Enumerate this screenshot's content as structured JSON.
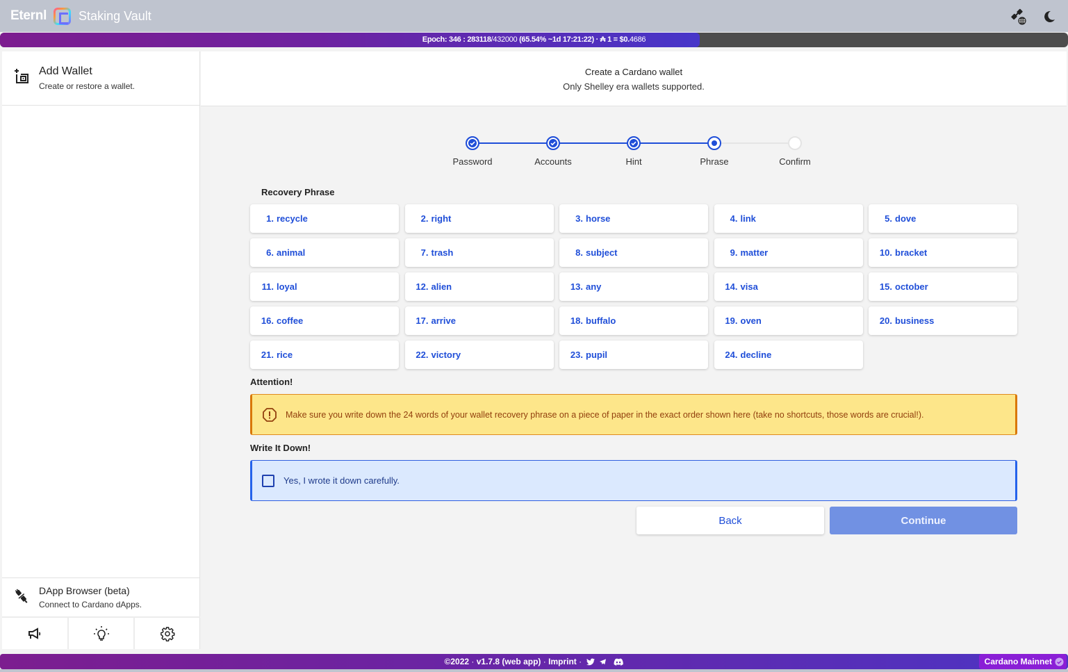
{
  "header": {
    "brand": "Eternl",
    "subtitle": "Staking Vault",
    "icons": [
      "dapp-network-icon",
      "dark-mode-moon-icon"
    ]
  },
  "epoch": {
    "label": "Epoch: 346 : 283118",
    "total": "/432000",
    "progress_text": " (65.54% ~1d 17:21:22) · ₳ 1 = $0.",
    "price_tail": "4686",
    "progress_fraction": 0.6554
  },
  "sidebar": {
    "add_wallet": {
      "title": "Add Wallet",
      "desc": "Create or restore a wallet.",
      "icon": "add-wallet-icon"
    },
    "dapp": {
      "title": "DApp Browser (beta)",
      "desc": "Connect to Cardano dApps.",
      "icon": "plug-icon"
    },
    "bottom_icons": [
      "megaphone-icon",
      "lightbulb-icon",
      "gear-icon"
    ]
  },
  "main": {
    "title": "Create a Cardano wallet",
    "subtitle": "Only Shelley era wallets supported."
  },
  "stepper": {
    "steps": [
      {
        "label": "Password",
        "state": "done"
      },
      {
        "label": "Accounts",
        "state": "done"
      },
      {
        "label": "Hint",
        "state": "done"
      },
      {
        "label": "Phrase",
        "state": "active"
      },
      {
        "label": "Confirm",
        "state": "todo"
      }
    ]
  },
  "recovery": {
    "label": "Recovery Phrase",
    "words": [
      {
        "n": "1.",
        "w": "recycle"
      },
      {
        "n": "2.",
        "w": "right"
      },
      {
        "n": "3.",
        "w": "horse"
      },
      {
        "n": "4.",
        "w": "link"
      },
      {
        "n": "5.",
        "w": "dove"
      },
      {
        "n": "6.",
        "w": "animal"
      },
      {
        "n": "7.",
        "w": "trash"
      },
      {
        "n": "8.",
        "w": "subject"
      },
      {
        "n": "9.",
        "w": "matter"
      },
      {
        "n": "10.",
        "w": "bracket"
      },
      {
        "n": "11.",
        "w": "loyal"
      },
      {
        "n": "12.",
        "w": "alien"
      },
      {
        "n": "13.",
        "w": "any"
      },
      {
        "n": "14.",
        "w": "visa"
      },
      {
        "n": "15.",
        "w": "october"
      },
      {
        "n": "16.",
        "w": "coffee"
      },
      {
        "n": "17.",
        "w": "arrive"
      },
      {
        "n": "18.",
        "w": "buffalo"
      },
      {
        "n": "19.",
        "w": "oven"
      },
      {
        "n": "20.",
        "w": "business"
      },
      {
        "n": "21.",
        "w": "rice"
      },
      {
        "n": "22.",
        "w": "victory"
      },
      {
        "n": "23.",
        "w": "pupil"
      },
      {
        "n": "24.",
        "w": "decline"
      }
    ]
  },
  "attention": {
    "label": "Attention!",
    "text": "Make sure you write down the 24 words of your wallet recovery phrase on a piece of paper in the exact order shown here (take no shortcuts, those words are crucial!).",
    "color": "#fde68a"
  },
  "write_down": {
    "label": "Write It Down!",
    "checkbox_label": "Yes, I wrote it down carefully.",
    "checked": false
  },
  "buttons": {
    "back": "Back",
    "continue": "Continue"
  },
  "footer": {
    "copyright": "©2022",
    "version": "v1.7.8 (web app)",
    "imprint": "Imprint",
    "network": "Cardano Mainnet"
  },
  "colors": {
    "accent": "#1f4ed8",
    "continue_disabled": "#7191e3",
    "epoch_gradient_start": "#7c1d8f",
    "epoch_gradient_end": "#4736c9"
  }
}
